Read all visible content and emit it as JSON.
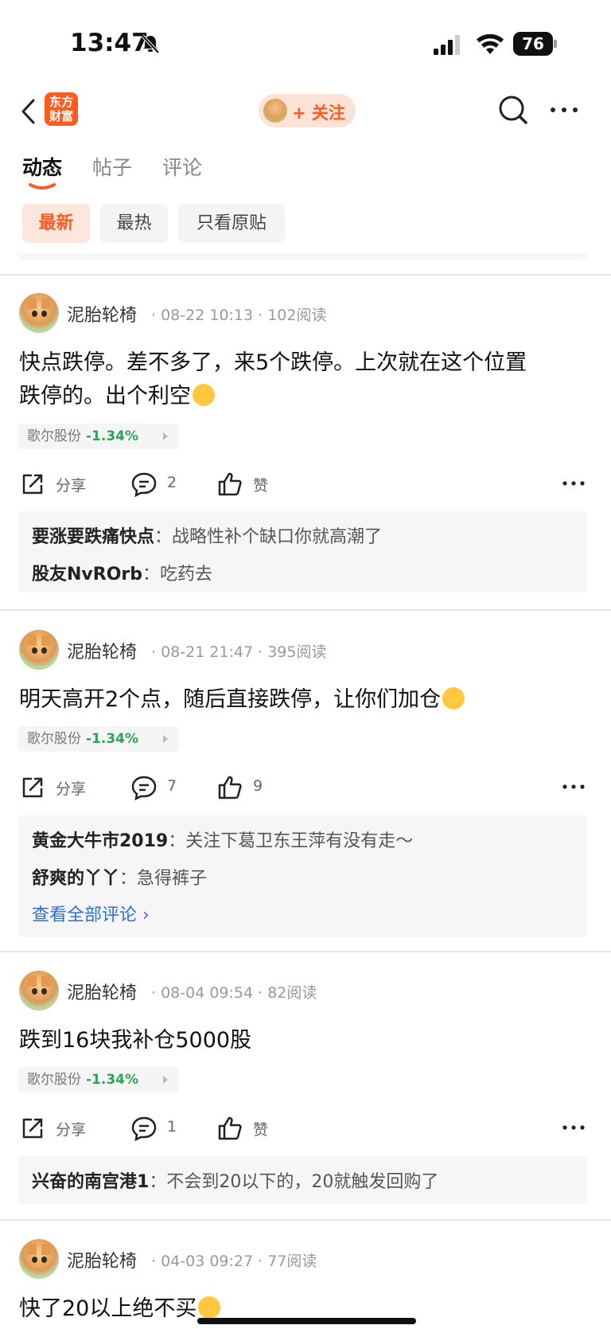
{
  "status": {
    "time": "13:47",
    "battery": "76"
  },
  "nav": {
    "logo_line1": "东方",
    "logo_line2": "财富",
    "follow_label": "+ 关注"
  },
  "tabs": [
    {
      "label": "动态"
    },
    {
      "label": "帖子"
    },
    {
      "label": "评论"
    }
  ],
  "filters": [
    {
      "label": "最新"
    },
    {
      "label": "最热"
    },
    {
      "label": "只看原贴"
    }
  ],
  "colors": {
    "accent": "#ff5a1f",
    "stock_down": "#2fa35a",
    "link": "#2f6fd6"
  },
  "posts": [
    {
      "username": "泥胎轮椅",
      "meta": "· 08-22 10:13 · 102阅读",
      "content_line1": "快点跌停。差不多了，来5个跌停。上次就在这个位置",
      "content_line2": "跌停的。出个利空",
      "emoji": "smiling-face",
      "stock_name": "歌尔股份",
      "stock_change": "-1.34%",
      "share": "分享",
      "comments": "2",
      "likes": "赞",
      "replies": [
        {
          "user": "要涨要跌痛快点",
          "text": "战略性补个缺口你就高潮了"
        },
        {
          "user": "股友NvROrb",
          "text": "吃药去"
        }
      ]
    },
    {
      "username": "泥胎轮椅",
      "meta": "· 08-21 21:47 · 395阅读",
      "content_line1": "明天高开2个点，随后直接跌停，让你们加仓",
      "emoji": "flushed-face",
      "stock_name": "歌尔股份",
      "stock_change": "-1.34%",
      "share": "分享",
      "comments": "7",
      "likes": "9",
      "replies": [
        {
          "user": "黄金大牛市2019",
          "text": "关注下葛卫东王萍有没有走～"
        },
        {
          "user": "舒爽的丫丫",
          "text": "急得裤子"
        }
      ],
      "view_all": "查看全部评论 ›"
    },
    {
      "username": "泥胎轮椅",
      "meta": "· 08-04 09:54 · 82阅读",
      "content_line1": "跌到16块我补仓5000股",
      "stock_name": "歌尔股份",
      "stock_change": "-1.34%",
      "share": "分享",
      "comments": "1",
      "likes": "赞",
      "replies": [
        {
          "user": "兴奋的南宫港1",
          "text": "不会到20以下的，20就触发回购了"
        }
      ]
    },
    {
      "username": "泥胎轮椅",
      "meta": "· 04-03 09:27 · 77阅读",
      "content_line1": "快了20以上绝不买",
      "emoji": "grimacing-face"
    }
  ]
}
